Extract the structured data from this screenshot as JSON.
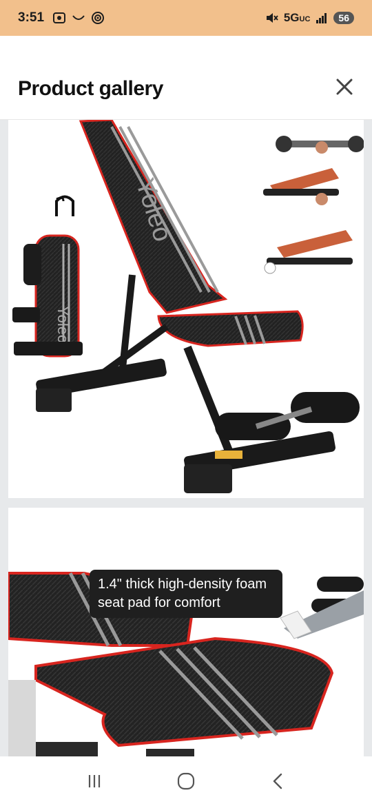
{
  "status_bar": {
    "time": "3:51",
    "network": "5G",
    "network_sub": "UC",
    "battery": "56"
  },
  "header": {
    "title": "Product gallery",
    "close_icon": "close-icon"
  },
  "gallery": {
    "images": [
      {
        "brand_text": "Yoleo",
        "icon": "product-image"
      },
      {
        "caption": "1.4\" thick high-density foam seat pad for comfort",
        "icon": "product-image"
      }
    ]
  },
  "navigation": {
    "recent_icon": "recent-apps-icon",
    "home_icon": "home-icon",
    "back_icon": "back-icon"
  },
  "colors": {
    "status_bar_bg": "#f2c08c",
    "gallery_bg": "#e7e9eb",
    "accent_red": "#d8251f",
    "pad_black": "#1e1e1e"
  }
}
